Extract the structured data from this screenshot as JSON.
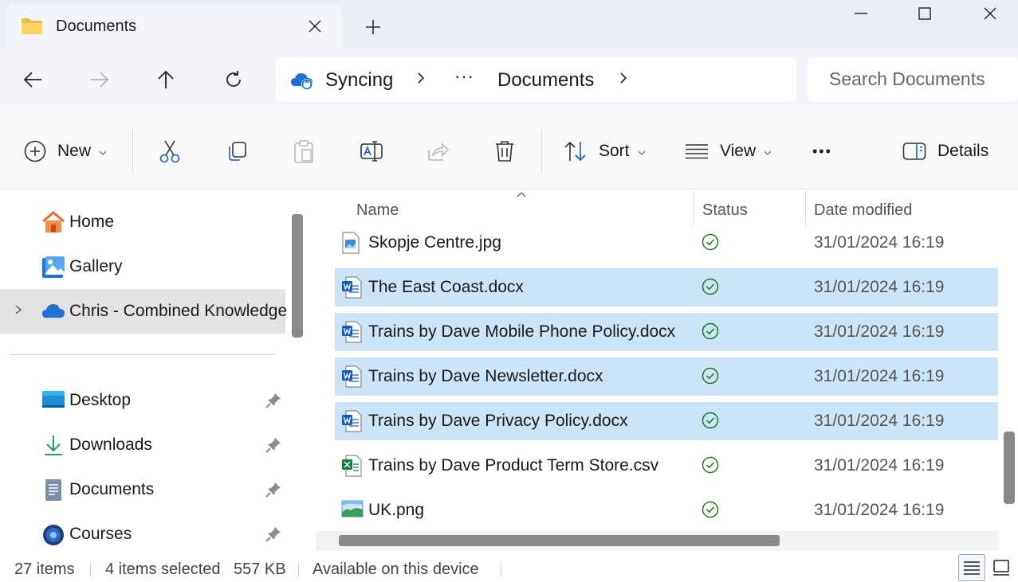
{
  "window": {
    "tab_title": "Documents",
    "new_tab": "+"
  },
  "nav": {
    "breadcrumb": [
      "Syncing",
      "Documents"
    ],
    "more": "···",
    "search_placeholder": "Search Documents"
  },
  "commandbar": {
    "new_label": "New",
    "sort_label": "Sort",
    "view_label": "View",
    "more_label": "•••",
    "details_label": "Details"
  },
  "sidebar": {
    "items": [
      {
        "label": "Home",
        "icon": "home-icon"
      },
      {
        "label": "Gallery",
        "icon": "gallery-icon"
      },
      {
        "label": "Chris - Combined Knowledge",
        "icon": "onedrive-cloud-icon",
        "selected": true
      },
      {
        "label": "Desktop",
        "icon": "desktop-icon",
        "pinned": true
      },
      {
        "label": "Downloads",
        "icon": "downloads-icon",
        "pinned": true
      },
      {
        "label": "Documents",
        "icon": "documents-icon",
        "pinned": true
      },
      {
        "label": "Courses",
        "icon": "courses-icon",
        "pinned": true
      }
    ]
  },
  "filelist": {
    "columns": [
      "Name",
      "Status",
      "Date modified"
    ],
    "rows": [
      {
        "name": "Skopje Centre.jpg",
        "type": "jpg",
        "status": "available",
        "date": "31/01/2024 16:19",
        "selected": false
      },
      {
        "name": "The East Coast.docx",
        "type": "docx",
        "status": "available",
        "date": "31/01/2024 16:19",
        "selected": true
      },
      {
        "name": "Trains by Dave Mobile Phone Policy.docx",
        "type": "docx",
        "status": "available",
        "date": "31/01/2024 16:19",
        "selected": true
      },
      {
        "name": "Trains by Dave Newsletter.docx",
        "type": "docx",
        "status": "available",
        "date": "31/01/2024 16:19",
        "selected": true
      },
      {
        "name": "Trains by Dave Privacy Policy.docx",
        "type": "docx",
        "status": "available",
        "date": "31/01/2024 16:19",
        "selected": true
      },
      {
        "name": "Trains by Dave Product Term Store.csv",
        "type": "csv",
        "status": "available",
        "date": "31/01/2024 16:19",
        "selected": false
      },
      {
        "name": "UK.png",
        "type": "png",
        "status": "available",
        "date": "31/01/2024 16:19",
        "selected": false
      }
    ]
  },
  "statusbar": {
    "item_count": "27 items",
    "selected": "4 items selected",
    "size": "557 KB",
    "availability": "Available on this device"
  },
  "colors": {
    "selection": "#cce4f7",
    "accent": "#0067c0",
    "word_blue": "#185abd",
    "excel_green": "#107c41",
    "status_green": "#0f7b0f"
  }
}
